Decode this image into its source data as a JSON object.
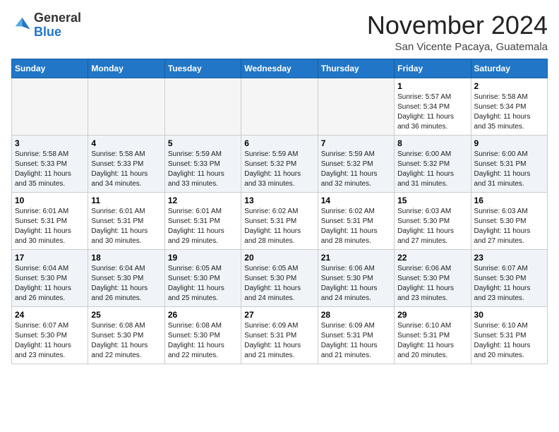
{
  "header": {
    "logo_general": "General",
    "logo_blue": "Blue",
    "month_title": "November 2024",
    "location": "San Vicente Pacaya, Guatemala"
  },
  "weekdays": [
    "Sunday",
    "Monday",
    "Tuesday",
    "Wednesday",
    "Thursday",
    "Friday",
    "Saturday"
  ],
  "weeks": [
    [
      {
        "day": "",
        "info": ""
      },
      {
        "day": "",
        "info": ""
      },
      {
        "day": "",
        "info": ""
      },
      {
        "day": "",
        "info": ""
      },
      {
        "day": "",
        "info": ""
      },
      {
        "day": "1",
        "info": "Sunrise: 5:57 AM\nSunset: 5:34 PM\nDaylight: 11 hours\nand 36 minutes."
      },
      {
        "day": "2",
        "info": "Sunrise: 5:58 AM\nSunset: 5:34 PM\nDaylight: 11 hours\nand 35 minutes."
      }
    ],
    [
      {
        "day": "3",
        "info": "Sunrise: 5:58 AM\nSunset: 5:33 PM\nDaylight: 11 hours\nand 35 minutes."
      },
      {
        "day": "4",
        "info": "Sunrise: 5:58 AM\nSunset: 5:33 PM\nDaylight: 11 hours\nand 34 minutes."
      },
      {
        "day": "5",
        "info": "Sunrise: 5:59 AM\nSunset: 5:33 PM\nDaylight: 11 hours\nand 33 minutes."
      },
      {
        "day": "6",
        "info": "Sunrise: 5:59 AM\nSunset: 5:32 PM\nDaylight: 11 hours\nand 33 minutes."
      },
      {
        "day": "7",
        "info": "Sunrise: 5:59 AM\nSunset: 5:32 PM\nDaylight: 11 hours\nand 32 minutes."
      },
      {
        "day": "8",
        "info": "Sunrise: 6:00 AM\nSunset: 5:32 PM\nDaylight: 11 hours\nand 31 minutes."
      },
      {
        "day": "9",
        "info": "Sunrise: 6:00 AM\nSunset: 5:31 PM\nDaylight: 11 hours\nand 31 minutes."
      }
    ],
    [
      {
        "day": "10",
        "info": "Sunrise: 6:01 AM\nSunset: 5:31 PM\nDaylight: 11 hours\nand 30 minutes."
      },
      {
        "day": "11",
        "info": "Sunrise: 6:01 AM\nSunset: 5:31 PM\nDaylight: 11 hours\nand 30 minutes."
      },
      {
        "day": "12",
        "info": "Sunrise: 6:01 AM\nSunset: 5:31 PM\nDaylight: 11 hours\nand 29 minutes."
      },
      {
        "day": "13",
        "info": "Sunrise: 6:02 AM\nSunset: 5:31 PM\nDaylight: 11 hours\nand 28 minutes."
      },
      {
        "day": "14",
        "info": "Sunrise: 6:02 AM\nSunset: 5:31 PM\nDaylight: 11 hours\nand 28 minutes."
      },
      {
        "day": "15",
        "info": "Sunrise: 6:03 AM\nSunset: 5:30 PM\nDaylight: 11 hours\nand 27 minutes."
      },
      {
        "day": "16",
        "info": "Sunrise: 6:03 AM\nSunset: 5:30 PM\nDaylight: 11 hours\nand 27 minutes."
      }
    ],
    [
      {
        "day": "17",
        "info": "Sunrise: 6:04 AM\nSunset: 5:30 PM\nDaylight: 11 hours\nand 26 minutes."
      },
      {
        "day": "18",
        "info": "Sunrise: 6:04 AM\nSunset: 5:30 PM\nDaylight: 11 hours\nand 26 minutes."
      },
      {
        "day": "19",
        "info": "Sunrise: 6:05 AM\nSunset: 5:30 PM\nDaylight: 11 hours\nand 25 minutes."
      },
      {
        "day": "20",
        "info": "Sunrise: 6:05 AM\nSunset: 5:30 PM\nDaylight: 11 hours\nand 24 minutes."
      },
      {
        "day": "21",
        "info": "Sunrise: 6:06 AM\nSunset: 5:30 PM\nDaylight: 11 hours\nand 24 minutes."
      },
      {
        "day": "22",
        "info": "Sunrise: 6:06 AM\nSunset: 5:30 PM\nDaylight: 11 hours\nand 23 minutes."
      },
      {
        "day": "23",
        "info": "Sunrise: 6:07 AM\nSunset: 5:30 PM\nDaylight: 11 hours\nand 23 minutes."
      }
    ],
    [
      {
        "day": "24",
        "info": "Sunrise: 6:07 AM\nSunset: 5:30 PM\nDaylight: 11 hours\nand 23 minutes."
      },
      {
        "day": "25",
        "info": "Sunrise: 6:08 AM\nSunset: 5:30 PM\nDaylight: 11 hours\nand 22 minutes."
      },
      {
        "day": "26",
        "info": "Sunrise: 6:08 AM\nSunset: 5:30 PM\nDaylight: 11 hours\nand 22 minutes."
      },
      {
        "day": "27",
        "info": "Sunrise: 6:09 AM\nSunset: 5:31 PM\nDaylight: 11 hours\nand 21 minutes."
      },
      {
        "day": "28",
        "info": "Sunrise: 6:09 AM\nSunset: 5:31 PM\nDaylight: 11 hours\nand 21 minutes."
      },
      {
        "day": "29",
        "info": "Sunrise: 6:10 AM\nSunset: 5:31 PM\nDaylight: 11 hours\nand 20 minutes."
      },
      {
        "day": "30",
        "info": "Sunrise: 6:10 AM\nSunset: 5:31 PM\nDaylight: 11 hours\nand 20 minutes."
      }
    ]
  ]
}
